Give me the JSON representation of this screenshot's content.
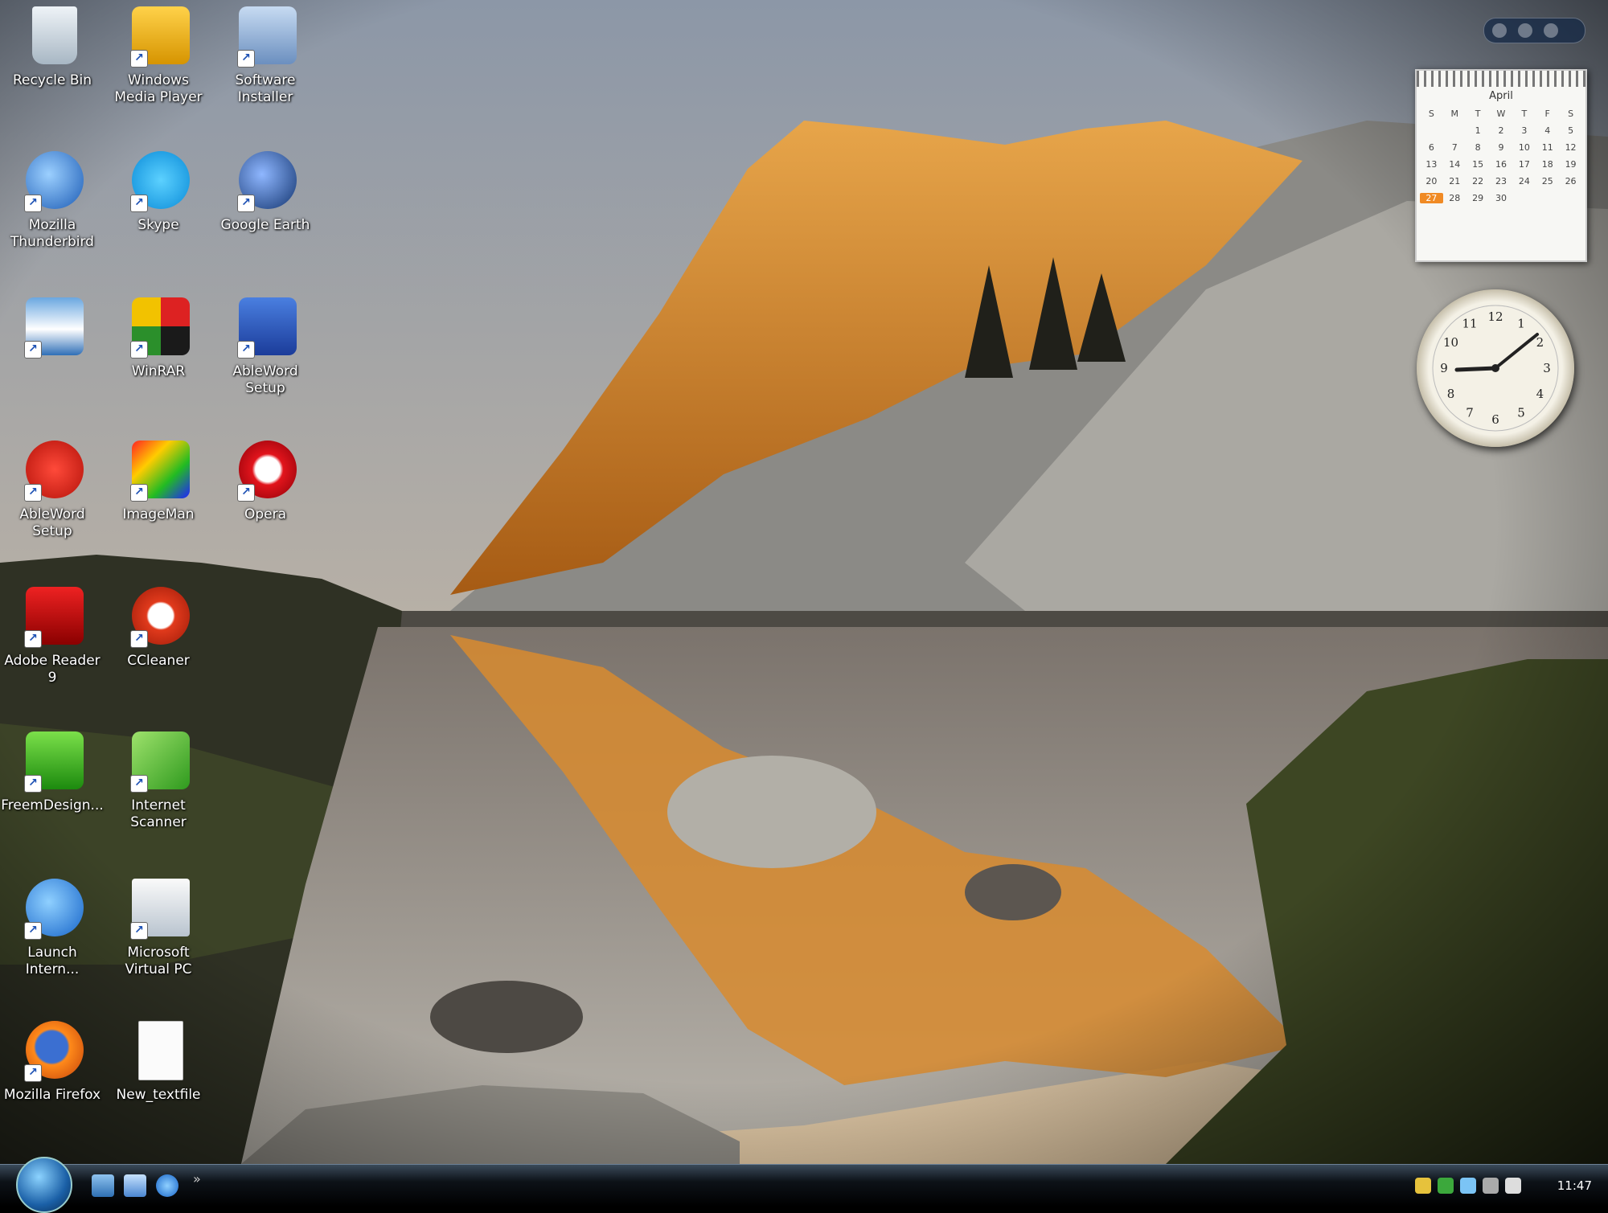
{
  "desktop": {
    "icons": [
      {
        "label": "Recycle Bin",
        "name": "recycle-bin"
      },
      {
        "label": "Windows Media Player",
        "name": "media-player"
      },
      {
        "label": "Software Installer",
        "name": "software-installer"
      },
      {
        "label": "Mozilla Thunderbird",
        "name": "thunderbird"
      },
      {
        "label": "Skype",
        "name": "skype"
      },
      {
        "label": "Google Earth",
        "name": "google-earth"
      },
      {
        "label": "",
        "name": "control-panel"
      },
      {
        "label": "WinRAR",
        "name": "winrar"
      },
      {
        "label": "AbleWord Setup",
        "name": "ableword"
      },
      {
        "label": "Adobe Reader 9",
        "name": "adobe-flash"
      },
      {
        "label": "ImageMan",
        "name": "imageman"
      },
      {
        "label": "Opera",
        "name": "opera"
      },
      {
        "label": "Adobe Reader 9",
        "name": "adobe-reader"
      },
      {
        "label": "CCleaner",
        "name": "ccleaner"
      },
      {
        "label": "FreemDesign...",
        "name": "freemdesign"
      },
      {
        "label": "Internet Scanner",
        "name": "internet-scanner"
      },
      {
        "label": "Launch Intern...",
        "name": "internet-explorer"
      },
      {
        "label": "Microsoft Virtual PC",
        "name": "virtual-pc"
      },
      {
        "label": "Mozilla Firefox",
        "name": "firefox"
      },
      {
        "label": "New_textfile",
        "name": "text-file"
      }
    ]
  },
  "gadgets": {
    "calendar": {
      "month": "April",
      "weekdays": [
        "S",
        "M",
        "T",
        "W",
        "T",
        "F",
        "S"
      ],
      "days": [
        "",
        "",
        "1",
        "2",
        "3",
        "4",
        "5",
        "6",
        "7",
        "8",
        "9",
        "10",
        "11",
        "12",
        "13",
        "14",
        "15",
        "16",
        "17",
        "18",
        "19",
        "20",
        "21",
        "22",
        "23",
        "24",
        "25",
        "26",
        "27",
        "28",
        "29",
        "30"
      ],
      "today": "27"
    },
    "clock": {
      "numerals": [
        "12",
        "1",
        "2",
        "3",
        "4",
        "5",
        "6",
        "7",
        "8",
        "9",
        "10",
        "11"
      ]
    }
  },
  "taskbar": {
    "time": "11:47"
  }
}
